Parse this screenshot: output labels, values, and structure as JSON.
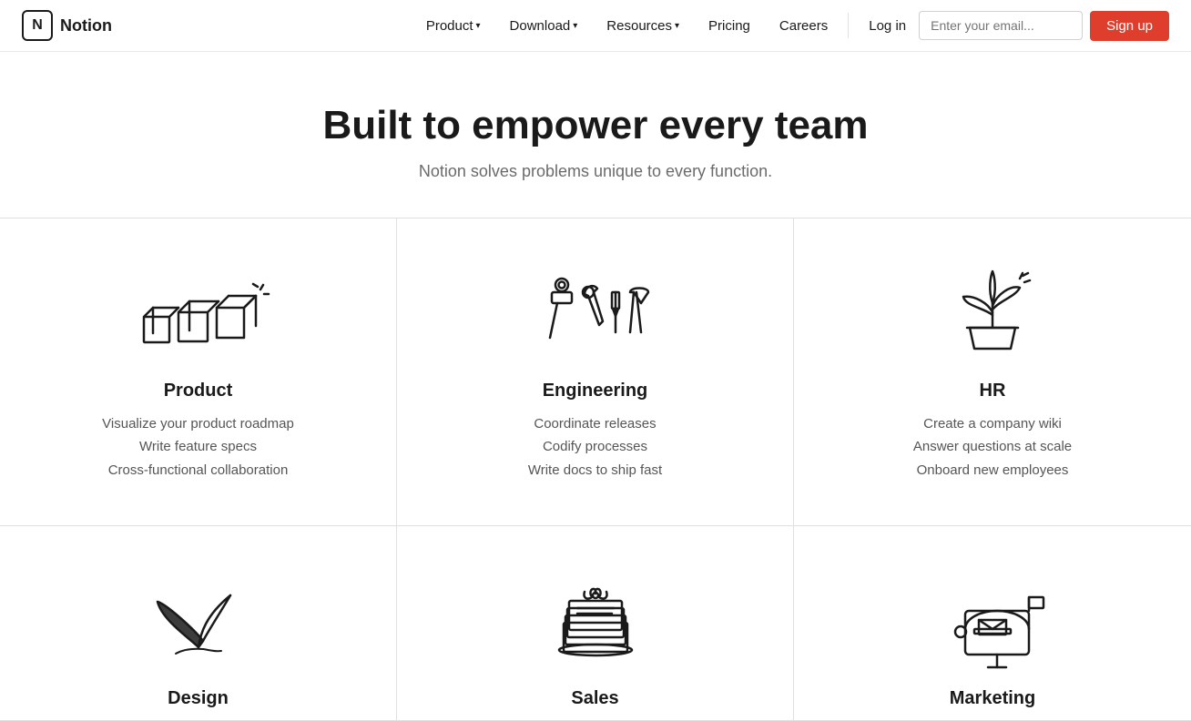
{
  "nav": {
    "logo_text": "Notion",
    "logo_letter": "N",
    "links": [
      {
        "label": "Product",
        "has_dropdown": true
      },
      {
        "label": "Download",
        "has_dropdown": true
      },
      {
        "label": "Resources",
        "has_dropdown": true
      },
      {
        "label": "Pricing",
        "has_dropdown": false
      },
      {
        "label": "Careers",
        "has_dropdown": false
      }
    ],
    "login_label": "Log in",
    "email_placeholder": "Enter your email...",
    "signup_label": "Sign up"
  },
  "hero": {
    "title": "Built to empower every team",
    "subtitle": "Notion solves problems unique to every function."
  },
  "cells": [
    {
      "id": "product",
      "title": "Product",
      "desc_lines": [
        "Visualize your product roadmap",
        "Write feature specs",
        "Cross-functional collaboration"
      ]
    },
    {
      "id": "engineering",
      "title": "Engineering",
      "desc_lines": [
        "Coordinate releases",
        "Codify processes",
        "Write docs to ship fast"
      ]
    },
    {
      "id": "hr",
      "title": "HR",
      "desc_lines": [
        "Create a company wiki",
        "Answer questions at scale",
        "Onboard new employees"
      ]
    },
    {
      "id": "design",
      "title": "Design",
      "desc_lines": []
    },
    {
      "id": "sales",
      "title": "Sales",
      "desc_lines": []
    },
    {
      "id": "marketing",
      "title": "Marketing",
      "desc_lines": []
    }
  ]
}
